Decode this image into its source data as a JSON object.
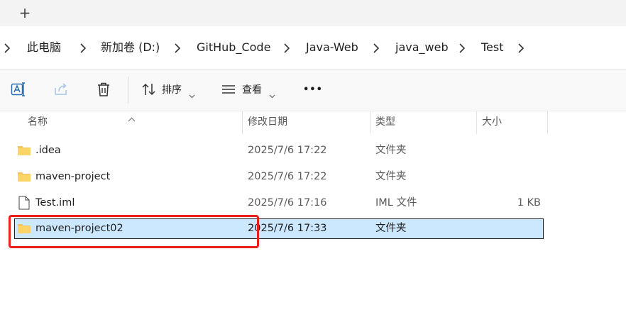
{
  "tabs": {
    "new_tab": "+"
  },
  "breadcrumb": [
    "此电脑",
    "新加卷 (D:)",
    "GitHub_Code",
    "Java-Web",
    "java_web",
    "Test"
  ],
  "toolbar": {
    "sort_label": "排序",
    "view_label": "查看",
    "more_label": "•••",
    "icons": [
      "translate-rename-icon",
      "share-icon",
      "delete-icon",
      "sort-icon",
      "view-icon",
      "more-icon"
    ]
  },
  "columns": {
    "name": "名称",
    "modified": "修改日期",
    "type": "类型",
    "size": "大小"
  },
  "files": [
    {
      "name": ".idea",
      "modified": "2025/7/6 17:22",
      "type": "文件夹",
      "size": "",
      "icon": "folder-icon"
    },
    {
      "name": "maven-project",
      "modified": "2025/7/6 17:22",
      "type": "文件夹",
      "size": "",
      "icon": "folder-icon"
    },
    {
      "name": "Test.iml",
      "modified": "2025/7/6 17:16",
      "type": "IML 文件",
      "size": "1 KB",
      "icon": "file-icon"
    },
    {
      "name": "maven-project02",
      "modified": "2025/7/6 17:33",
      "type": "文件夹",
      "size": "",
      "icon": "folder-icon",
      "selected": true
    }
  ],
  "colors": {
    "selection": "#cce8ff",
    "annotation": "#e8211b",
    "folder": "#f6c65b"
  }
}
